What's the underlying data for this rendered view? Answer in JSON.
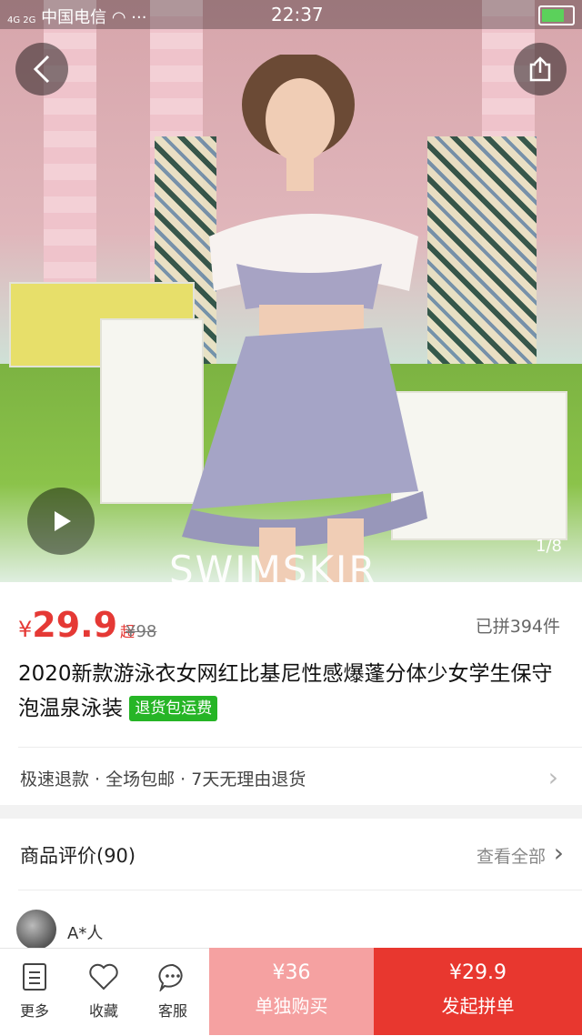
{
  "status_bar": {
    "signal": "4G 2G",
    "carrier": "中国电信",
    "time": "22:37"
  },
  "hero": {
    "counter": "1/8",
    "overlay_text": "SWIMSKIR"
  },
  "product": {
    "currency": "¥",
    "price": "29.9",
    "price_suffix": "起",
    "original_price": "¥98",
    "sold": "已拼394件",
    "title": "2020新款游泳衣女网红比基尼性感爆蓬分体少女学生保守泡温泉泳装",
    "tag": "退货包运费",
    "services": "极速退款 · 全场包邮 · 7天无理由退货"
  },
  "review": {
    "title": "商品评价(90)",
    "view_all": "查看全部",
    "reviewer": "A*人"
  },
  "bottom_bar": {
    "more": "更多",
    "favorite": "收藏",
    "service": "客服",
    "alone_price": "¥36",
    "alone_label": "单独购买",
    "group_price": "¥29.9",
    "group_label": "发起拼单"
  },
  "colors": {
    "price_red": "#e53935",
    "tag_green": "#26b526",
    "group_btn": "#e8372f",
    "alone_btn": "#f5a1a1"
  },
  "icons": [
    "back-icon",
    "share-icon",
    "play-icon",
    "chevron-right-icon",
    "more-icon",
    "heart-icon",
    "chat-icon"
  ]
}
